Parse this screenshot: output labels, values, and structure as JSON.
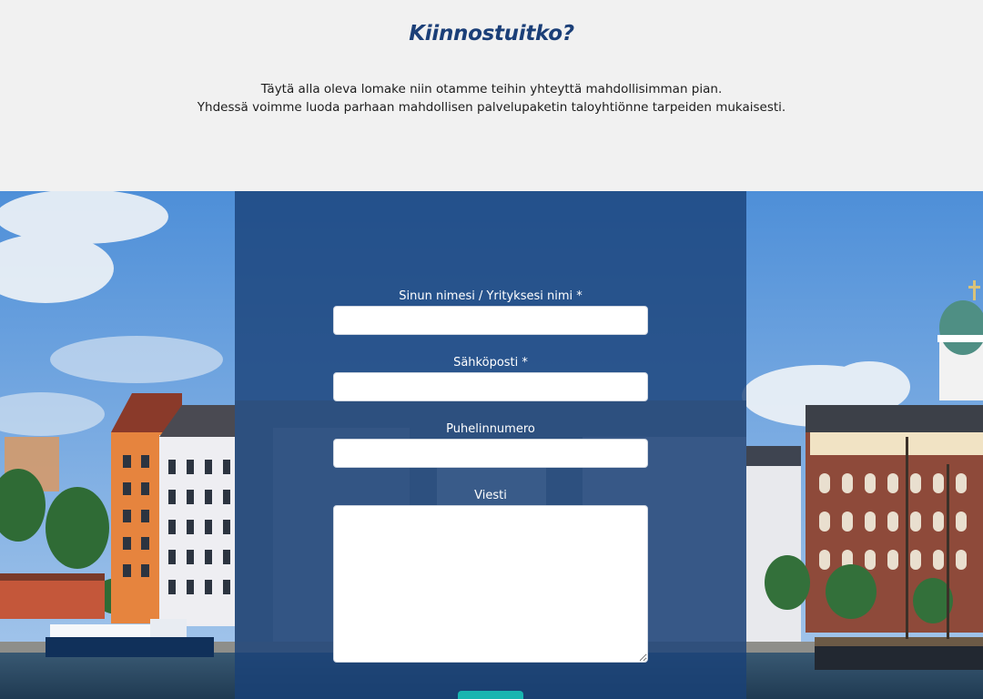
{
  "intro": {
    "title": "Kiinnostuitko?",
    "line1": "Täytä alla oleva lomake niin otamme teihin yhteyttä mahdollisimman pian.",
    "line2": "Yhdessä voimme luoda parhaan mahdollisen palvelupaketin taloyhtiönne tarpeiden mukaisesti."
  },
  "form": {
    "name_label": "Sinun nimesi / Yrityksesi nimi *",
    "name_value": "",
    "email_label": "Sähköposti *",
    "email_value": "",
    "phone_label": "Puhelinnumero",
    "phone_value": "",
    "message_label": "Viesti",
    "message_value": ""
  },
  "colors": {
    "background": "#f1f1f1",
    "title": "#1b3f78",
    "panel": "#19417a",
    "submit": "#19b5b0"
  }
}
